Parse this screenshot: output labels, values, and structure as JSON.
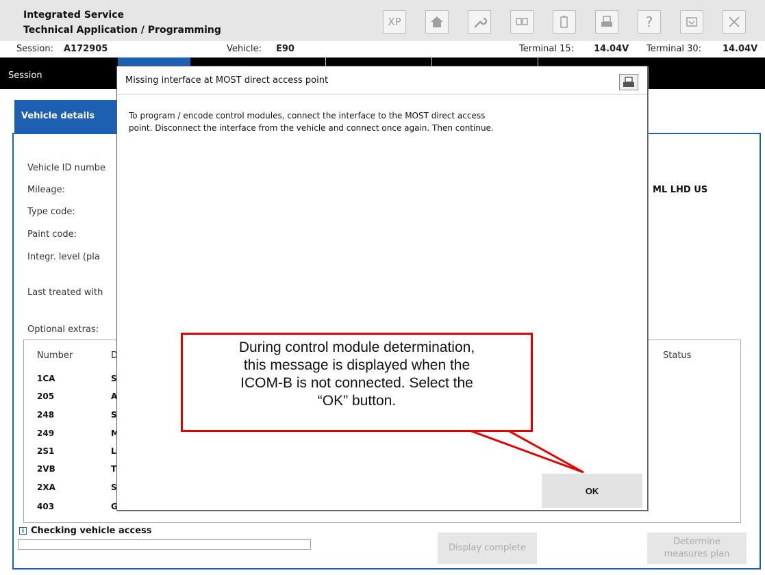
{
  "header": {
    "title_line1": "Integrated Service",
    "title_line2": "Technical Application / Programming",
    "toolbar": [
      {
        "name": "xp-button",
        "label": "XP",
        "icon": "xp-icon"
      },
      {
        "name": "home-button",
        "label": "",
        "icon": "home-icon"
      },
      {
        "name": "workshop-button",
        "label": "",
        "icon": "wrench-icon"
      },
      {
        "name": "display-button",
        "label": "",
        "icon": "display-icon"
      },
      {
        "name": "battery-button",
        "label": "",
        "icon": "battery-icon"
      },
      {
        "name": "print-button",
        "label": "",
        "icon": "printer-icon"
      },
      {
        "name": "help-button",
        "label": "?",
        "icon": "help-icon"
      },
      {
        "name": "minimize-button",
        "label": "",
        "icon": "minimize-icon"
      },
      {
        "name": "close-button",
        "label": "",
        "icon": "close-icon"
      }
    ]
  },
  "session_line": {
    "session_label": "Session:",
    "session_value": "A172905",
    "vehicle_label": "Vehicle:",
    "vehicle_value": "E90",
    "t15_label": "Terminal 15:",
    "t15_value": "14.04V",
    "t30_label": "Terminal 30:",
    "t30_value": "14.04V"
  },
  "menu": {
    "session": "Session"
  },
  "vehicle_details": {
    "tab_label": "Vehicle details",
    "fields": [
      {
        "label": "Vehicle ID numbe"
      },
      {
        "label": "Mileage:"
      },
      {
        "label": "Type code:"
      },
      {
        "label": "Paint code:"
      },
      {
        "label": "Integr. level (pla"
      },
      {
        "label": "Last treated with"
      }
    ],
    "type_code_value_fragment": "ML LHD US",
    "optional_extras_label": "Optional extras:",
    "table": {
      "col_number": "Number",
      "col_desc_fragment": "D",
      "col_status": "Status",
      "rows": [
        {
          "number": "1CA",
          "desc": "S"
        },
        {
          "number": "205",
          "desc": "A"
        },
        {
          "number": "248",
          "desc": "S"
        },
        {
          "number": "249",
          "desc": "M"
        },
        {
          "number": "2S1",
          "desc": "L"
        },
        {
          "number": "2VB",
          "desc": "T"
        },
        {
          "number": "2XA",
          "desc": "S"
        },
        {
          "number": "403",
          "desc": "G"
        }
      ]
    }
  },
  "status": {
    "text": "Checking vehicle access",
    "progress": 0
  },
  "buttons": {
    "display_complete": "Display complete",
    "determine_line1": "Determine",
    "determine_line2": "measures plan"
  },
  "dialog": {
    "title": "Missing interface at MOST direct access point",
    "message_line1": "To program / encode control modules, connect the interface to the MOST direct access",
    "message_line2": "point. Disconnect the interface from the vehicle and connect once again. Then continue.",
    "ok_label": "OK"
  },
  "callout": {
    "line1": "During control module determination,",
    "line2": "this message is displayed when the",
    "line3": "ICOM-B is not connected. Select the",
    "line4": "“OK” button."
  },
  "colors": {
    "accent_blue": "#1d5fb0",
    "menu_black": "#000000",
    "callout_red": "#e00000",
    "header_gray": "#e6e6e6"
  }
}
